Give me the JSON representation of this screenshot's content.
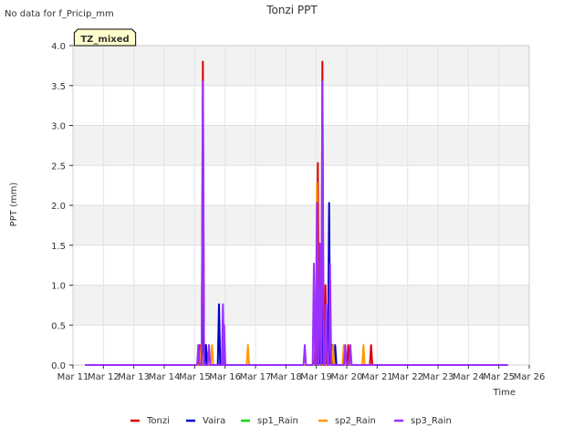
{
  "chart_data": {
    "type": "line",
    "title": "Tonzi PPT",
    "top_note": "No data for f_Pricip_mm",
    "badge": "TZ_mixed",
    "xlabel": "Time",
    "ylabel": "PPT (mm)",
    "xlim": [
      11,
      26
    ],
    "ylim": [
      0,
      4.0
    ],
    "x_ticks": [
      11,
      12,
      13,
      14,
      15,
      16,
      17,
      18,
      19,
      20,
      21,
      22,
      23,
      24,
      25,
      26
    ],
    "x_tick_labels": [
      "Mar 11",
      "Mar 12",
      "Mar 13",
      "Mar 14",
      "Mar 15",
      "Mar 16",
      "Mar 17",
      "Mar 18",
      "Mar 19",
      "Mar 20",
      "Mar 21",
      "Mar 22",
      "Mar 23",
      "Mar 24",
      "Mar 25",
      "Mar 26"
    ],
    "y_ticks": [
      0.0,
      0.5,
      1.0,
      1.5,
      2.0,
      2.5,
      3.0,
      3.5,
      4.0
    ],
    "y_tick_labels": [
      "0.0",
      "0.5",
      "1.0",
      "1.5",
      "2.0",
      "2.5",
      "3.0",
      "3.5",
      "4.0"
    ],
    "grid": true,
    "legend_position": "bottom",
    "data_range": [
      11.4,
      25.3
    ],
    "series": [
      {
        "name": "Tonzi",
        "color": "#dd0000",
        "spikes": [
          [
            15.17,
            0.25
          ],
          [
            15.27,
            3.8
          ],
          [
            15.37,
            0.25
          ],
          [
            18.97,
            0.25
          ],
          [
            19.05,
            2.53
          ],
          [
            19.12,
            1.0
          ],
          [
            19.2,
            3.8
          ],
          [
            19.3,
            1.0
          ],
          [
            19.4,
            0.25
          ],
          [
            19.55,
            0.25
          ],
          [
            20.05,
            0.25
          ],
          [
            20.8,
            0.25
          ]
        ]
      },
      {
        "name": "Vaira",
        "color": "#0000cc",
        "spikes": [
          [
            15.28,
            0.76
          ],
          [
            15.37,
            0.25
          ],
          [
            15.8,
            0.76
          ],
          [
            19.08,
            0.76
          ],
          [
            19.22,
            0.76
          ],
          [
            19.42,
            2.03
          ],
          [
            19.52,
            0.25
          ],
          [
            19.62,
            0.25
          ]
        ]
      },
      {
        "name": "sp1_Rain",
        "color": "#00dd00",
        "spikes": []
      },
      {
        "name": "sp2_Rain",
        "color": "#ff9900",
        "spikes": [
          [
            15.22,
            0.25
          ],
          [
            15.57,
            0.25
          ],
          [
            16.75,
            0.25
          ],
          [
            19.02,
            2.28
          ],
          [
            19.55,
            0.25
          ],
          [
            19.9,
            0.25
          ],
          [
            20.55,
            0.25
          ]
        ]
      },
      {
        "name": "sp3_Rain",
        "color": "#9b30ff",
        "spikes": [
          [
            15.12,
            0.25
          ],
          [
            15.27,
            3.55
          ],
          [
            15.47,
            0.25
          ],
          [
            15.93,
            0.76
          ],
          [
            15.97,
            0.5
          ],
          [
            18.62,
            0.25
          ],
          [
            18.92,
            1.27
          ],
          [
            19.02,
            2.03
          ],
          [
            19.12,
            1.52
          ],
          [
            19.2,
            3.55
          ],
          [
            19.32,
            0.76
          ],
          [
            19.45,
            1.27
          ],
          [
            19.95,
            0.25
          ],
          [
            20.12,
            0.25
          ]
        ]
      }
    ]
  }
}
